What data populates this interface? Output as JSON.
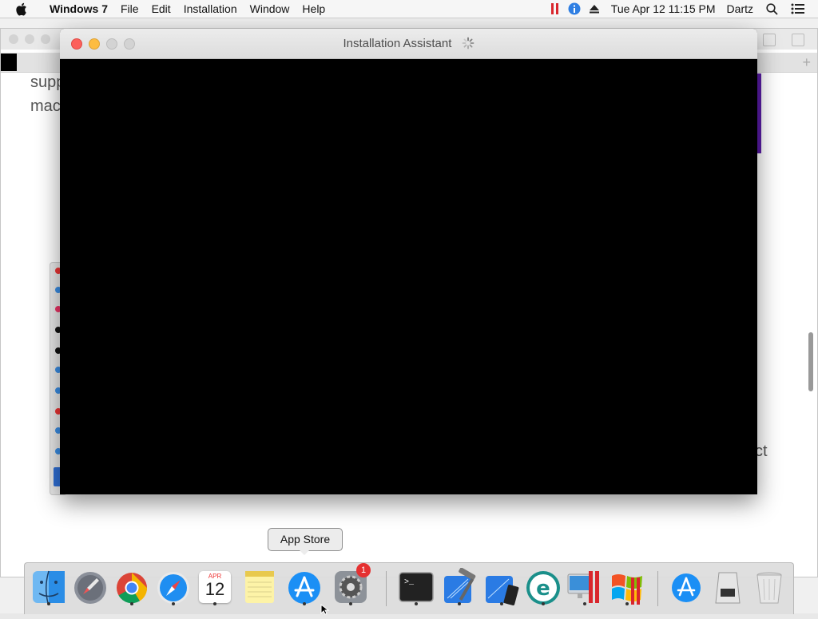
{
  "menubar": {
    "app_name": "Windows 7",
    "items": [
      "File",
      "Edit",
      "Installation",
      "Window",
      "Help"
    ],
    "clock": "Tue Apr 12  11:15 PM",
    "user": "Dartz"
  },
  "background_window": {
    "text_line_1": "supp",
    "text_line_2": "mac",
    "text_right": "ct"
  },
  "main_window": {
    "title": "Installation Assistant"
  },
  "tooltip": {
    "label": "App Store"
  },
  "dock": {
    "calendar_month": "APR",
    "calendar_day": "12",
    "system_prefs_badge": "1"
  },
  "colors": {
    "close": "#fc605b",
    "minimize": "#fdbc40",
    "inactive": "#d3d3d3",
    "window_content": "#000000"
  }
}
